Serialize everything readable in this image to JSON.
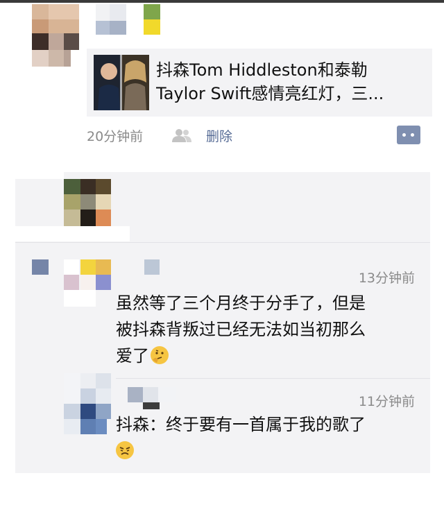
{
  "post": {
    "link_title_line1": "抖森Tom Hiddleston和泰勒",
    "link_title_line2": "Taylor Swift感情亮红灯，三...",
    "time": "20分钟前",
    "delete_label": "删除",
    "visibility_icon": "friends-icon",
    "comment_icon": "comment-icon"
  },
  "comments": [
    {
      "time": "13分钟前",
      "lines": [
        "虽然等了三个月终于分手了，但是",
        "被抖森背叛过已经无法如当初那么",
        "爱了"
      ],
      "emoji": "thinking-face-emoji"
    },
    {
      "time": "11分钟前",
      "lines": [
        "抖森：终于要有一首属于我的歌了"
      ],
      "emoji": "angry-face-emoji"
    }
  ]
}
